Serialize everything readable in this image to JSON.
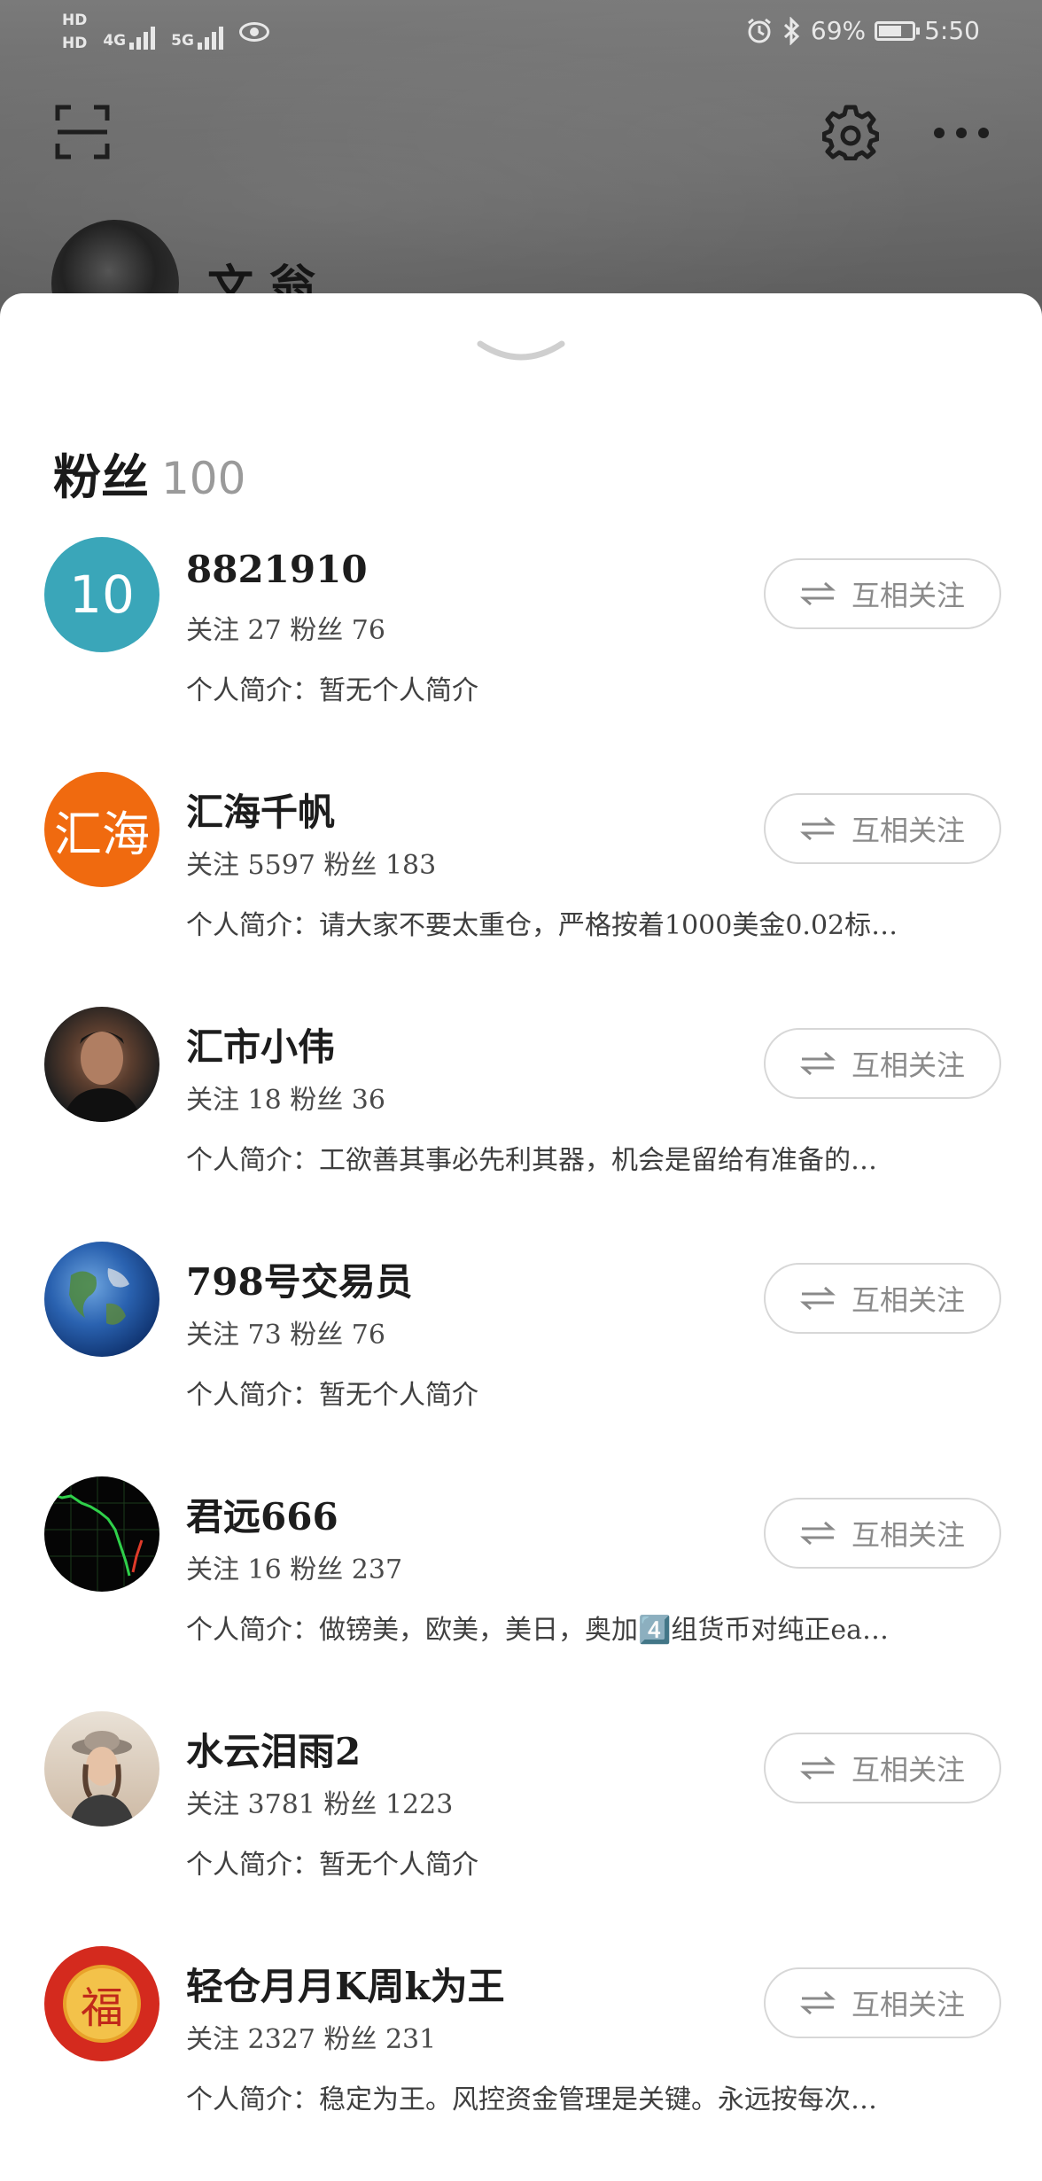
{
  "status_bar": {
    "hd1": "HD",
    "hd2": "HD",
    "net1": "4G",
    "net2": "5G",
    "battery": "69%",
    "time": "5:50"
  },
  "profile": {
    "name": "文 翁"
  },
  "sheet": {
    "title": "粉丝",
    "count": "100"
  },
  "labels": {
    "mutual_follow": "互相关注"
  },
  "followers": [
    {
      "name": "8821910",
      "stats": "关注 27 粉丝 76",
      "bio": "个人简介：暂无个人简介",
      "avatar_text": "10",
      "avatar_color": "#3aa6b9"
    },
    {
      "name": "汇海千帆",
      "stats": "关注 5597 粉丝 183",
      "bio": "个人简介：请大家不要太重仓，严格按着1000美金0.02标…",
      "avatar_text": "汇海",
      "avatar_color": "#f06a0f"
    },
    {
      "name": "汇市小伟",
      "stats": "关注 18 粉丝 36",
      "bio": "个人简介：工欲善其事必先利其器，机会是留给有准备的…",
      "avatar_text": "",
      "avatar_color": "#2a2a2a"
    },
    {
      "name": "798号交易员",
      "stats": "关注 73 粉丝 76",
      "bio": "个人简介：暂无个人简介",
      "avatar_text": "",
      "avatar_color": "#1c5aa8"
    },
    {
      "name": "君远666",
      "stats": "关注 16 粉丝 237",
      "bio": "个人简介：做镑美，欧美，美日，奥加4️⃣组货币对纯正ea…",
      "avatar_text": "",
      "avatar_color": "#050505"
    },
    {
      "name": "水云泪雨2",
      "stats": "关注 3781 粉丝 1223",
      "bio": "个人简介：暂无个人简介",
      "avatar_text": "",
      "avatar_color": "#d8c8b8"
    },
    {
      "name": "轻仓月月K周k为王",
      "stats": "关注 2327 粉丝 231",
      "bio": "个人简介：稳定为王。风控资金管理是关键。永远按每次…",
      "avatar_text": "福",
      "avatar_color": "#d42a1e"
    }
  ]
}
